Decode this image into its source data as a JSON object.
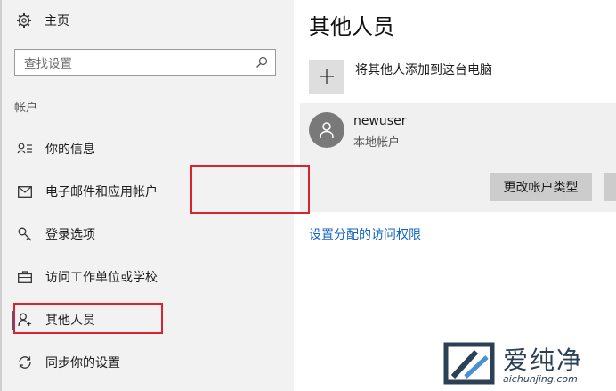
{
  "sidebar": {
    "home_label": "主页",
    "search_placeholder": "查找设置",
    "section_label": "帐户",
    "items": [
      {
        "label": "你的信息",
        "icon": "person-card-icon"
      },
      {
        "label": "电子邮件和应用帐户",
        "icon": "envelope-icon"
      },
      {
        "label": "登录选项",
        "icon": "key-icon"
      },
      {
        "label": "访问工作单位或学校",
        "icon": "briefcase-icon"
      },
      {
        "label": "其他人员",
        "icon": "person-add-icon",
        "active": true
      },
      {
        "label": "同步你的设置",
        "icon": "sync-icon"
      }
    ]
  },
  "main": {
    "title": "其他人员",
    "add_label": "将其他人添加到这台电脑",
    "user": {
      "name": "newuser",
      "type": "本地帐户",
      "change_button": "更改帐户类型"
    },
    "access_link": "设置分配的访问权限"
  },
  "watermark": {
    "brand": "爱纯净",
    "url": "aichunjing.com"
  },
  "colors": {
    "accent": "#1565c0",
    "highlight": "#d9232e",
    "sidebar_bg": "#f2f2f2"
  }
}
